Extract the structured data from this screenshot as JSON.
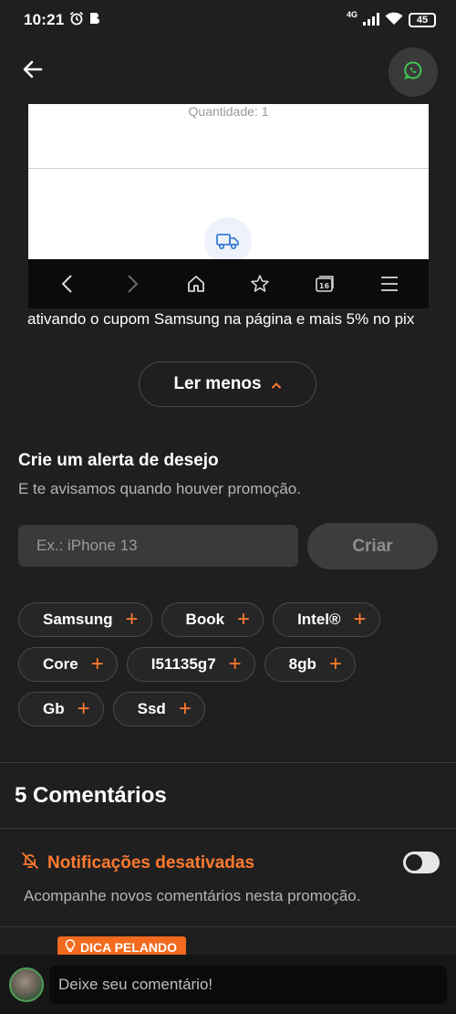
{
  "status_bar": {
    "time": "10:21",
    "network": "4G",
    "battery": "45"
  },
  "embed": {
    "quantity_label": "Quantidade: 1"
  },
  "description": {
    "text": "ativando o cupom Samsung na página e mais 5% no pix"
  },
  "read_less": {
    "label": "Ler menos"
  },
  "wish_alert": {
    "title": "Crie um alerta de desejo",
    "subtitle": "E te avisamos quando houver promoção.",
    "input_placeholder": "Ex.: iPhone 13",
    "create_label": "Criar"
  },
  "tags": [
    "Samsung",
    "Book",
    "Intel®",
    "Core",
    "I51135g7",
    "8gb",
    "Gb",
    "Ssd"
  ],
  "comments": {
    "count_label": "5 Comentários",
    "notifications_label": "Notificações desativadas",
    "notifications_on": false,
    "notifications_sub": "Acompanhe novos comentários nesta promoção.",
    "tip_badge": "DICA PELANDO"
  },
  "composer": {
    "placeholder": "Deixe seu comentário!"
  },
  "colors": {
    "background": "#1f1f1f",
    "accent": "#ff7a2f",
    "tip_badge": "#f26a1e",
    "whatsapp": "#3fc452"
  },
  "icons": {
    "back": "arrow-left-icon",
    "whatsapp": "whatsapp-icon",
    "truck": "truck-icon",
    "bell_off": "bell-off-icon",
    "lightbulb": "lightbulb-icon"
  }
}
